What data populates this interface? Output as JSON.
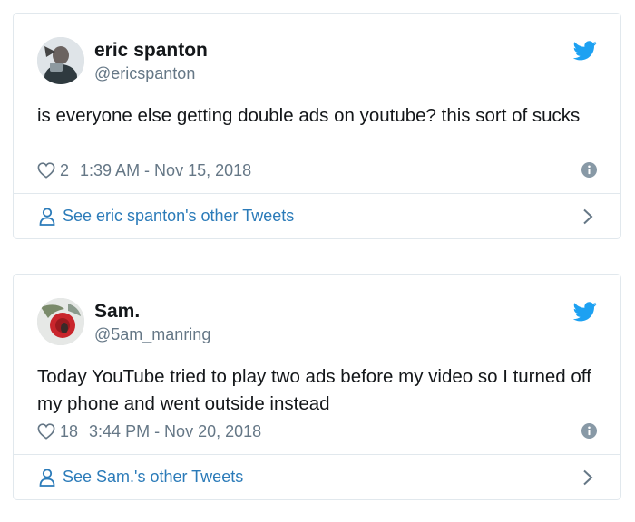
{
  "tweets": [
    {
      "display_name": "eric spanton",
      "handle": "@ericspanton",
      "text": "is everyone else getting double ads on youtube? this sort of sucks",
      "likes": "2",
      "timestamp": "1:39 AM - Nov 15, 2018",
      "footer_link": "See eric spanton's other Tweets"
    },
    {
      "display_name": "Sam.",
      "handle": "@5am_manring",
      "text": "Today YouTube tried to play two ads before my video so I turned off my phone and went outside instead",
      "likes": "18",
      "timestamp": "3:44 PM - Nov 20, 2018",
      "footer_link": "See Sam.'s other Tweets"
    }
  ],
  "colors": {
    "twitter_blue": "#1da1f2",
    "link_blue": "#2b7bb9",
    "muted_gray": "#657786",
    "border": "#e1e8ed"
  },
  "icons": [
    "twitter-bird-icon",
    "heart-icon",
    "info-icon",
    "person-icon",
    "chevron-right-icon"
  ]
}
